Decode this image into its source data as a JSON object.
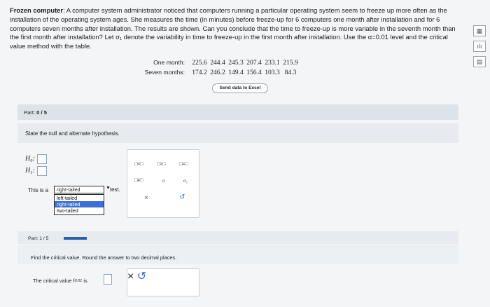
{
  "problem": {
    "title": "Frozen computer",
    "text": ": A computer system administrator noticed that computers running a particular operating system seem to freeze up more often as the installation of the operating system ages. She measures the time (in minutes) before freeze-up for 6 computers one month after installation and for 6 computers seven months after installation. The results are shown. Can you conclude that the time to freeze-up is more variable in the seventh month than the first month after installation? Let σ₁ denote the variability in time to freeze-up in the first month after installation. Use the α=0.01 level and the critical value method with the table."
  },
  "table": {
    "one_month_label": "One month:",
    "seven_months_label": "Seven months:",
    "one_month": [
      "225.6",
      "244.4",
      "245.3",
      "207.4",
      "233.1",
      "215.9"
    ],
    "seven_months": [
      "174.2",
      "246.2",
      "149.4",
      "156.4",
      "103.3",
      "84.3"
    ]
  },
  "send_button": "Send data to Excel",
  "part1": {
    "label_prefix": "Part: ",
    "label_value": "0 / 5",
    "question": "State the null and alternate hypothesis.",
    "h0": "H₀:",
    "h1": "H₁:",
    "tail_prefix": "This is a",
    "tail_selected": "right-tailed",
    "tail_suffix": "test.",
    "tail_options": [
      "left-tailed",
      "right-tailed",
      "two-tailed"
    ]
  },
  "palette": {
    "lt": "□<□",
    "gt": "□>□",
    "eq": "□=□",
    "ne": "□≠□",
    "sigma": "σ",
    "sigma1": "σ₁",
    "clear": "×",
    "undo": "↺"
  },
  "part2": {
    "label": "Part: 1 / 5",
    "question": "Find the critical value. Round the answer to two decimal places.",
    "cv_label": "The critical value f",
    "cv_sub": "0.01",
    "cv_is": "is",
    "clear": "×",
    "undo": "↺"
  },
  "side_icons": [
    "table-icon",
    "calculator-icon",
    "reference-icon"
  ]
}
